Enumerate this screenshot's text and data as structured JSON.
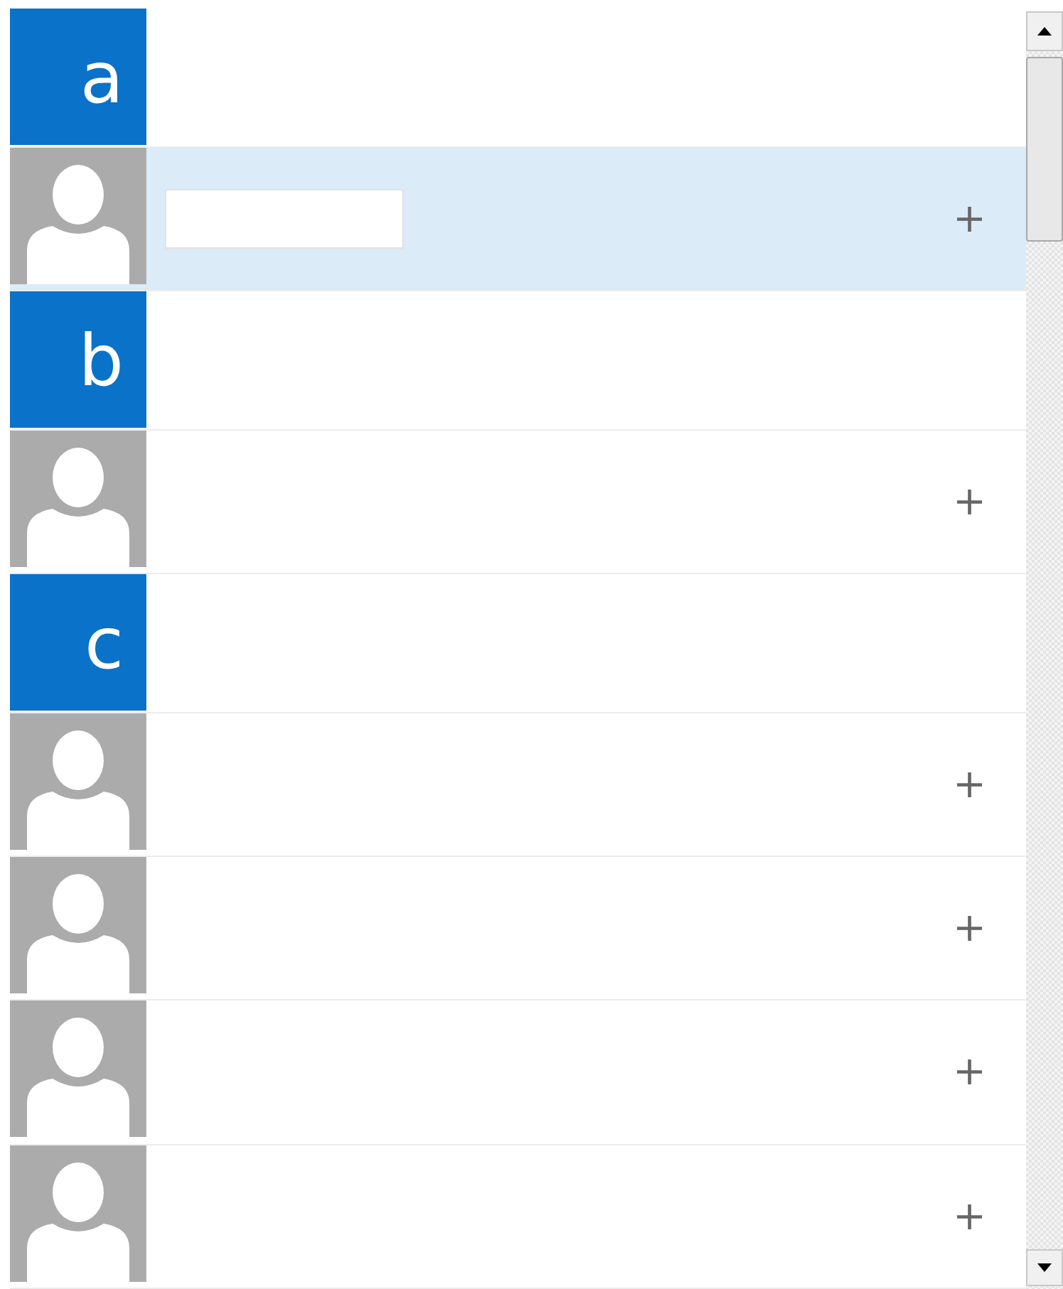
{
  "contacts_list": {
    "items": [
      {
        "kind": "header",
        "letter": "a"
      },
      {
        "kind": "contact",
        "selected": true,
        "name_hidden": true,
        "action": "+"
      },
      {
        "kind": "header",
        "letter": "b"
      },
      {
        "kind": "contact",
        "selected": false,
        "name_hidden": false,
        "action": "+"
      },
      {
        "kind": "header",
        "letter": "c"
      },
      {
        "kind": "contact",
        "selected": false,
        "name_hidden": false,
        "action": "+"
      },
      {
        "kind": "contact",
        "selected": false,
        "name_hidden": false,
        "action": "+"
      },
      {
        "kind": "contact",
        "selected": false,
        "name_hidden": false,
        "action": "+"
      },
      {
        "kind": "contact",
        "selected": false,
        "name_hidden": false,
        "action": "+"
      }
    ]
  }
}
